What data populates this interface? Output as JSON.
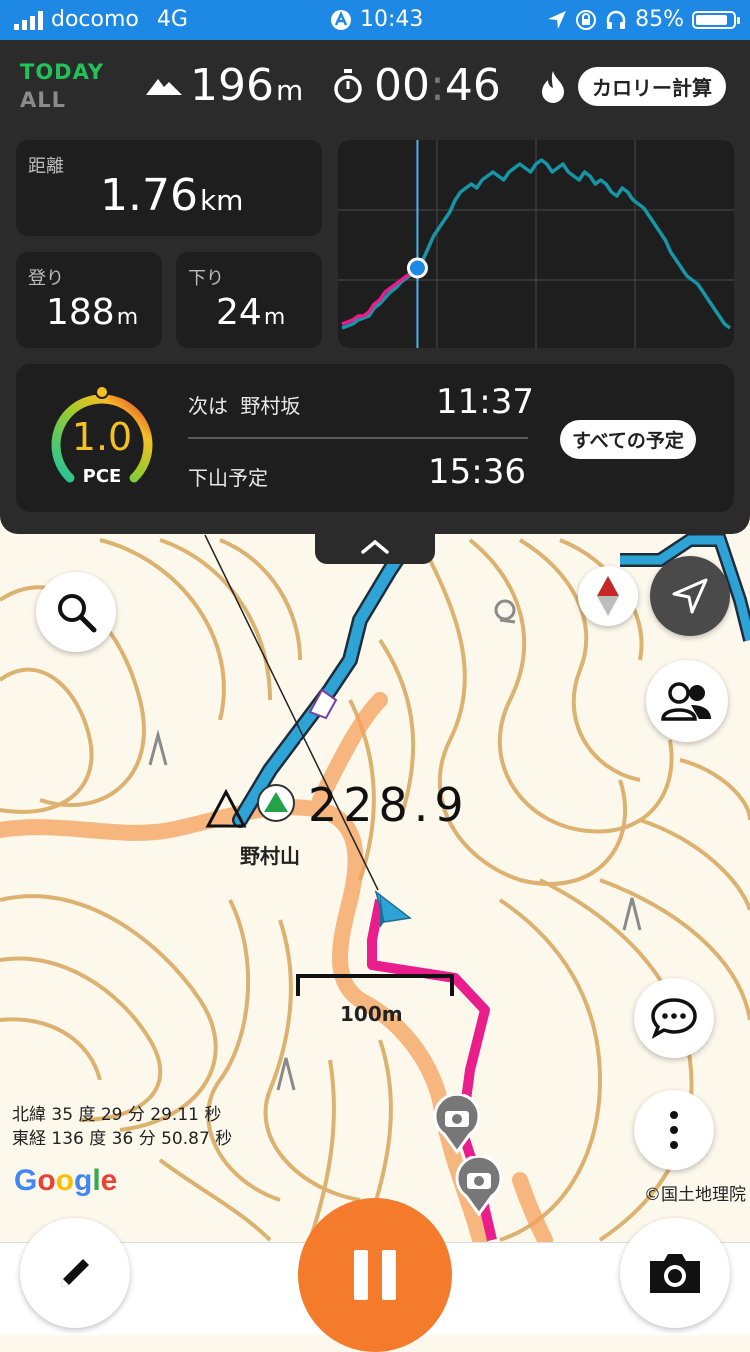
{
  "status": {
    "carrier": "docomo",
    "network": "4G",
    "time": "10:43",
    "battery": "85%",
    "battery_level": 0.85
  },
  "header": {
    "today_label": "TODAY",
    "all_label": "ALL",
    "altitude_value": "196",
    "altitude_unit": "m",
    "timer_hours": "00",
    "timer_minutes": "46",
    "calorie_button": "カロリー計算"
  },
  "stats": {
    "distance_label": "距離",
    "distance_value": "1.76",
    "distance_unit": "km",
    "climb_label": "登り",
    "climb_value": "188",
    "climb_unit": "m",
    "descent_label": "下り",
    "descent_value": "24",
    "descent_unit": "m"
  },
  "chart_data": {
    "type": "line",
    "title": "",
    "xlabel": "",
    "ylabel": "",
    "grid": true,
    "current_index": 14,
    "series": [
      {
        "color": "#e91e8c",
        "values": [
          8,
          9,
          10,
          12,
          12,
          14,
          18,
          20,
          24,
          26,
          28,
          30,
          32,
          34,
          36
        ]
      },
      {
        "color": "#1597a8",
        "values": [
          6,
          7,
          8,
          10,
          11,
          12,
          16,
          18,
          21,
          24,
          26,
          29,
          31,
          33,
          36,
          40,
          46,
          52,
          56,
          60,
          64,
          70,
          74,
          76,
          78,
          76,
          80,
          82,
          84,
          82,
          80,
          84,
          86,
          88,
          86,
          84,
          88,
          90,
          88,
          84,
          86,
          88,
          84,
          82,
          80,
          84,
          82,
          78,
          80,
          78,
          74,
          72,
          76,
          74,
          70,
          68,
          66,
          62,
          58,
          54,
          50,
          44,
          40,
          36,
          32,
          30,
          28,
          24,
          20,
          16,
          12,
          8,
          6
        ]
      }
    ]
  },
  "schedule": {
    "pce_value": "1.0",
    "pce_label": "PCE",
    "next_prefix": "次は",
    "next_place": "野村坂",
    "next_time": "11:37",
    "descent_label": "下山予定",
    "descent_time": "15:36",
    "all_button": "すべての予定"
  },
  "map": {
    "peak_name": "野村山",
    "elevation_text": "228.9",
    "scale_label": "100m",
    "lat_text": "北緯 35 度 29 分 29.11 秒",
    "lon_text": "東経 136 度 36 分 50.87 秒",
    "google_logo": "Google",
    "attribution": "©国土地理院",
    "colors": {
      "route_planned": "#2ea3d5",
      "route_walked": "#e91e8c",
      "contour": "#d8a55a",
      "trail": "#f5a05a"
    }
  },
  "controls": {
    "record_color": "#f47a2c"
  }
}
